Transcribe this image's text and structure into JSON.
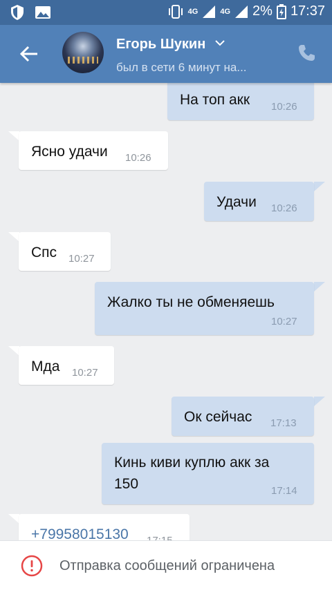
{
  "status_bar": {
    "network_a": "4G",
    "network_b": "4G",
    "battery": "2%",
    "time": "17:37"
  },
  "header": {
    "contact_name": "Егорь Шукин",
    "last_seen": "был в сети 6 минут на..."
  },
  "messages": [
    {
      "direction": "outgoing",
      "text": "На топ акк",
      "time": "10:26"
    },
    {
      "direction": "incoming",
      "text": "Ясно удачи",
      "time": "10:26"
    },
    {
      "direction": "outgoing",
      "text": "Удачи",
      "time": "10:26"
    },
    {
      "direction": "incoming",
      "text": "Спс",
      "time": "10:27"
    },
    {
      "direction": "outgoing",
      "text": "Жалко ты не обменяешь",
      "time": "10:27"
    },
    {
      "direction": "incoming",
      "text": "Мда",
      "time": "10:27"
    },
    {
      "direction": "outgoing",
      "text": "Ок сейчас",
      "time": "17:13"
    },
    {
      "direction": "outgoing",
      "text_line1": "Кинь киви куплю акк за",
      "text_line2": "150",
      "time": "17:14"
    },
    {
      "direction": "incoming",
      "text": "+79958015130",
      "time": "17:15"
    }
  ],
  "notice": {
    "text": "Отправка сообщений ограничена"
  },
  "colors": {
    "status_bar": "#3f6a9c",
    "app_bar": "#5181b8",
    "outgoing_bubble": "#cddcef",
    "incoming_bubble": "#ffffff",
    "chat_background": "#edeef0",
    "warning": "#e64646",
    "link": "#4a76a8"
  },
  "icons": [
    "shield-icon",
    "image-icon",
    "vibrate-icon",
    "signal-icon",
    "battery-icon",
    "back-arrow-icon",
    "chevron-down-icon",
    "phone-icon",
    "warning-icon"
  ]
}
